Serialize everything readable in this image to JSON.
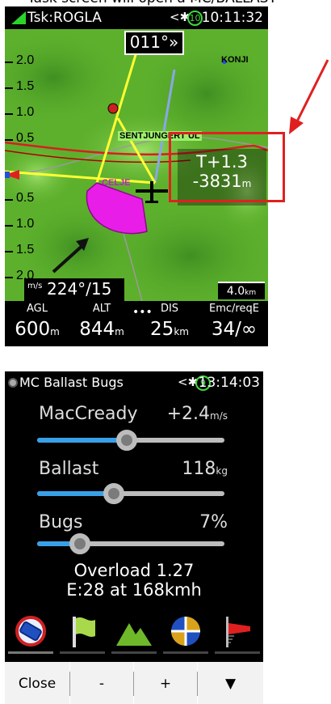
{
  "caption": "Task screen will open a MC/BALLAST",
  "map_screen": {
    "title": "Tsk:ROGLA",
    "bluetooth_icon": "bluetooth-icon",
    "satellites": "10",
    "time": "10:11:32",
    "heading": "011°",
    "heading_arrows": "»",
    "scale_labels": [
      "2.0",
      "1.5",
      "1.0",
      "0.5",
      "0.5",
      "1.0",
      "1.5",
      "2.0"
    ],
    "poi": {
      "konji": "KONJI",
      "sentjungert": "SENTJUNGERT UL",
      "celje": "CELJE"
    },
    "info_line1": "T+1.3",
    "info_value": "-3831",
    "info_unit": "m",
    "wind_unit": "m/s",
    "wind": "224°/15",
    "scale_value": "4.0",
    "scale_unit": "km",
    "nav_dots": "•••",
    "nav": [
      {
        "label": "AGL",
        "value": "600",
        "unit": "m"
      },
      {
        "label": "ALT",
        "value": "844",
        "unit": "m"
      },
      {
        "label": "DIS",
        "value": "25",
        "unit": "km"
      },
      {
        "label": "Emc/reqE",
        "value": "34/∞",
        "unit": ""
      }
    ],
    "colors": {
      "terrain": "#5db02c",
      "track": "#ffff33",
      "route": "#d62020",
      "glide": "#e81ee8"
    }
  },
  "mc_screen": {
    "title": "MC Ballast Bugs",
    "bluetooth_icon": "bluetooth-icon",
    "satellites": "9",
    "time": "13:14:03",
    "rows": [
      {
        "label": "MacCready",
        "value": "+2.4",
        "unit": "m/s",
        "level": 0.48
      },
      {
        "label": "Ballast",
        "value": "118",
        "unit": "kg",
        "level": 0.41
      },
      {
        "label": "Bugs",
        "value": "7%",
        "unit": "",
        "level": 0.23
      }
    ],
    "overload_line1": "Overload 1.27",
    "overload_line2": "E:28 at 168kmh",
    "icons": [
      "glider-icon",
      "flag-icon",
      "mountain-icon",
      "compass-icon",
      "windsock-icon"
    ],
    "buttons": [
      "Close",
      "-",
      "+",
      "▼"
    ],
    "colors": {
      "slider_fill": "#39a0e8",
      "flag": "#a9d94b",
      "mountain": "#6fb82a",
      "compass": "#d9a21a"
    }
  }
}
